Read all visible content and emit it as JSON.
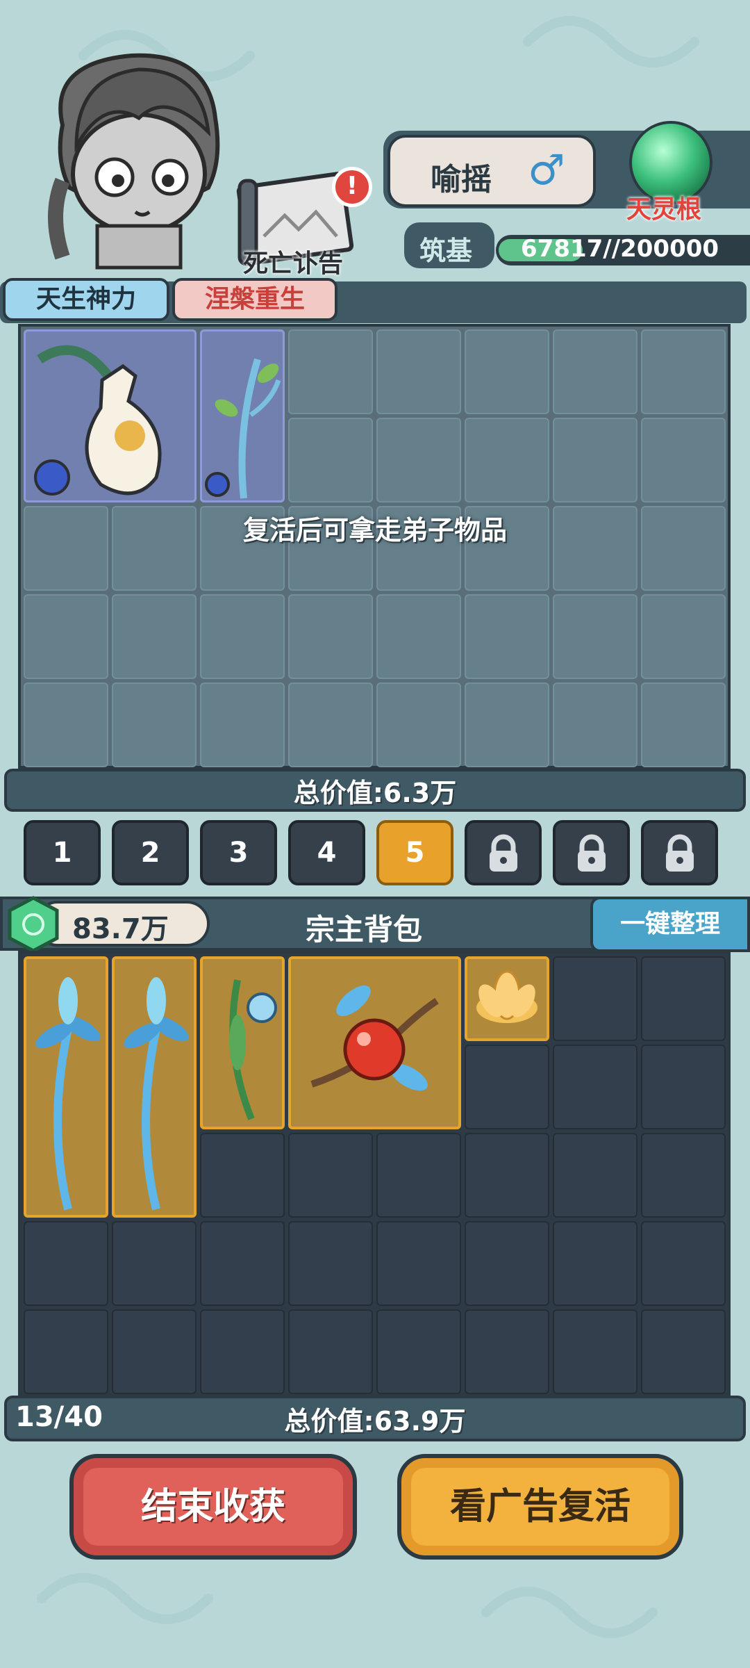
{
  "character": {
    "name": "喻摇",
    "gender_symbol": "♂",
    "spirit_root": "天灵根",
    "realm": "筑基",
    "exp_text": "67817//200000",
    "exp_progress": 0.339
  },
  "death_notice": {
    "label": "死亡讣告",
    "alert": "!"
  },
  "traits": [
    "天生神力",
    "涅槃重生"
  ],
  "disciple_inventory": {
    "hint": "复活后可拿走弟子物品",
    "total_value": "总价值:6.3万",
    "items": [
      {
        "icon": "gourd-bottle-icon"
      },
      {
        "icon": "frost-branch-icon"
      }
    ]
  },
  "pages": [
    {
      "label": "1",
      "locked": false,
      "active": false
    },
    {
      "label": "2",
      "locked": false,
      "active": false
    },
    {
      "label": "3",
      "locked": false,
      "active": false
    },
    {
      "label": "4",
      "locked": false,
      "active": false
    },
    {
      "label": "5",
      "locked": false,
      "active": true
    },
    {
      "label": "",
      "locked": true,
      "active": false
    },
    {
      "label": "",
      "locked": true,
      "active": false
    },
    {
      "label": "",
      "locked": true,
      "active": false
    }
  ],
  "sect_bag": {
    "money": "83.7万",
    "title": "宗主背包",
    "sort_button": "一键整理",
    "count": "13/40",
    "total_value": "总价值:63.9万",
    "items": [
      {
        "icon": "blue-spirit-flower-icon"
      },
      {
        "icon": "blue-spirit-flower-icon"
      },
      {
        "icon": "bellflower-herb-icon"
      },
      {
        "icon": "red-spirit-fruit-icon"
      },
      {
        "icon": "golden-lotus-icon"
      }
    ]
  },
  "buttons": {
    "end_harvest": "结束收获",
    "watch_ad_revive": "看广告复活"
  },
  "colors": {
    "background": "#b9d7d7",
    "panel": "#3f5a65",
    "accent_gold": "#e8a22c",
    "danger_red": "#e0605a"
  }
}
